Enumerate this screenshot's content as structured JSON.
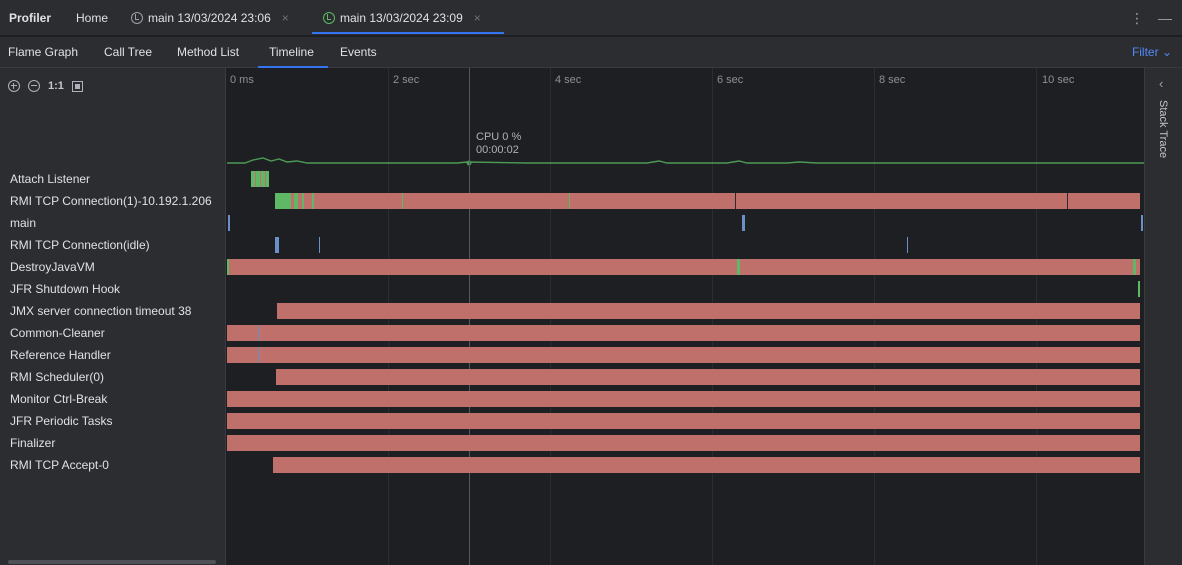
{
  "topbar": {
    "app_title": "Profiler",
    "home_label": "Home",
    "tabs": [
      {
        "label": "main 13/03/2024 23:06",
        "active": false
      },
      {
        "label": "main 13/03/2024 23:09",
        "active": true
      }
    ],
    "close_glyph": "×",
    "more_glyph": "⋮",
    "minimize_glyph": "—"
  },
  "views": {
    "tabs": [
      "Flame Graph",
      "Call Tree",
      "Method List",
      "Timeline",
      "Events"
    ],
    "active": "Timeline",
    "filter_label": "Filter ⌄"
  },
  "zoom": {
    "reset_label": "1:1"
  },
  "ruler": {
    "ticks": [
      "0 ms",
      "2 sec",
      "4 sec",
      "6 sec",
      "8 sec",
      "10 sec"
    ]
  },
  "cursor": {
    "cpu_label": "CPU 0 %",
    "time_label": "00:00:02"
  },
  "threads": [
    {
      "name": "Attach Listener"
    },
    {
      "name": "RMI TCP Connection(1)-10.192.1.206"
    },
    {
      "name": "main"
    },
    {
      "name": "RMI TCP Connection(idle)"
    },
    {
      "name": "DestroyJavaVM"
    },
    {
      "name": "JFR Shutdown Hook"
    },
    {
      "name": "JMX server connection timeout 38"
    },
    {
      "name": "Common-Cleaner"
    },
    {
      "name": "Reference Handler"
    },
    {
      "name": "RMI Scheduler(0)"
    },
    {
      "name": "Monitor Ctrl-Break"
    },
    {
      "name": "JFR Periodic Tasks"
    },
    {
      "name": "Finalizer"
    },
    {
      "name": "RMI TCP Accept-0"
    }
  ],
  "right_panel": {
    "collapse_glyph": "‹",
    "label": "Stack Trace"
  },
  "colors": {
    "waiting_bar": "#c0706a",
    "running_mark": "#5fb865",
    "selected_accent": "#3574f0",
    "idle_mark": "#6b8fc9",
    "cpu_line": "#4b9b55"
  }
}
